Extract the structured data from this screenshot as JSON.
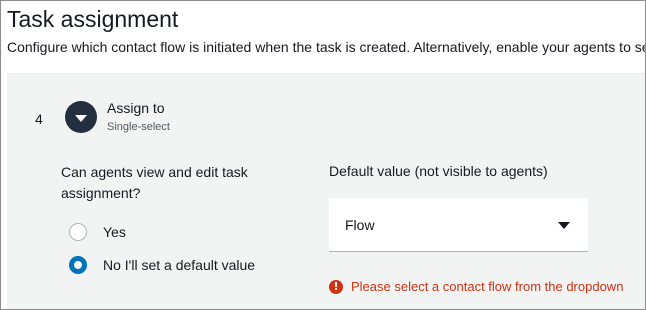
{
  "header": {
    "title": "Task assignment",
    "description": "Configure which contact flow is initiated when the task is created. Alternatively, enable your agents to sel"
  },
  "field": {
    "number": "4",
    "name": "Assign to",
    "type": "Single-select",
    "toggle_icon": "caret-down-icon"
  },
  "permission": {
    "question": "Can agents view and edit task assignment?",
    "options": [
      {
        "label": "Yes",
        "checked": false
      },
      {
        "label": "No I'll set a default value",
        "checked": true
      }
    ]
  },
  "default_value": {
    "label": "Default value (not visible to agents)",
    "selected": "Flow",
    "error_icon": "!",
    "error": "Please select a contact flow from the dropdown"
  },
  "colors": {
    "accent": "#0073bb",
    "error": "#d13212",
    "panel": "#f2f3f3",
    "toggle": "#232f3e"
  }
}
